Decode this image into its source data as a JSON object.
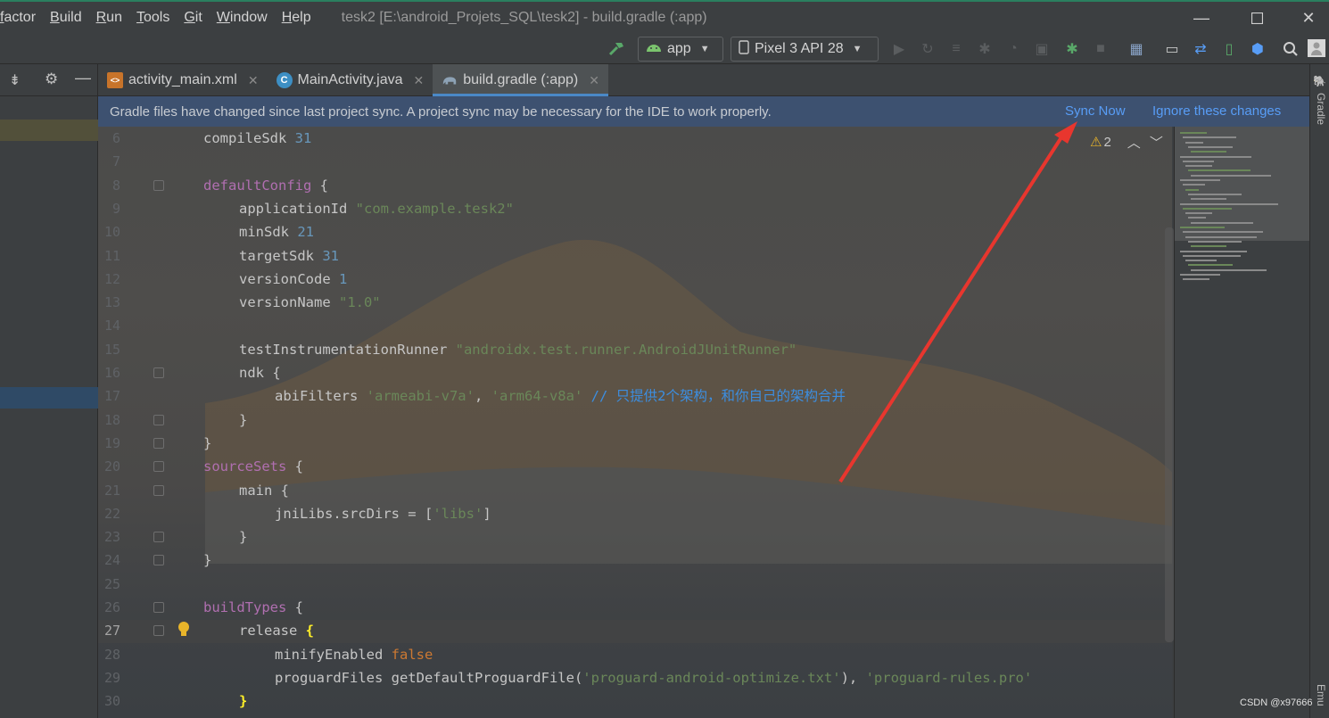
{
  "menu": [
    "factor",
    "Build",
    "Run",
    "Tools",
    "Git",
    "Window",
    "Help"
  ],
  "window_title": "tesk2 [E:\\android_Projets_SQL\\tesk2] - build.gradle (:app)",
  "toolbar": {
    "config": "app",
    "device": "Pixel 3 API 28"
  },
  "tabs": [
    {
      "label": "activity_main.xml",
      "icon": "xml-file-icon"
    },
    {
      "label": "MainActivity.java",
      "icon": "java-class-icon",
      "glyph": "C"
    },
    {
      "label": "build.gradle (:app)",
      "icon": "gradle-elephant-icon"
    }
  ],
  "banner": {
    "message": "Gradle files have changed since last project sync. A project sync may be necessary for the IDE to work properly.",
    "sync_now": "Sync Now",
    "ignore": "Ignore these changes"
  },
  "inspections": {
    "warnings": "2"
  },
  "current_line": 27,
  "code_lines": [
    {
      "n": "6",
      "text": "compileSdk 31"
    },
    {
      "n": "7",
      "text": ""
    },
    {
      "n": "8",
      "text": "defaultConfig {"
    },
    {
      "n": "9",
      "text": "applicationId \"com.example.tesk2\""
    },
    {
      "n": "10",
      "text": "minSdk 21"
    },
    {
      "n": "11",
      "text": "targetSdk 31"
    },
    {
      "n": "12",
      "text": "versionCode 1"
    },
    {
      "n": "13",
      "text": "versionName \"1.0\""
    },
    {
      "n": "14",
      "text": ""
    },
    {
      "n": "15",
      "text": "testInstrumentationRunner \"androidx.test.runner.AndroidJUnitRunner\""
    },
    {
      "n": "16",
      "text": "ndk {"
    },
    {
      "n": "17",
      "text": "abiFilters 'armeabi-v7a', 'arm64-v8a' // 只提供2个架构，和你自己的架构合并"
    },
    {
      "n": "18",
      "text": "}"
    },
    {
      "n": "19",
      "text": "}"
    },
    {
      "n": "20",
      "text": "sourceSets {"
    },
    {
      "n": "21",
      "text": "main {"
    },
    {
      "n": "22",
      "text": "jniLibs.srcDirs = ['libs']"
    },
    {
      "n": "23",
      "text": "}"
    },
    {
      "n": "24",
      "text": "}"
    },
    {
      "n": "25",
      "text": ""
    },
    {
      "n": "26",
      "text": "buildTypes {"
    },
    {
      "n": "27",
      "text": "release {"
    },
    {
      "n": "28",
      "text": "minifyEnabled false"
    },
    {
      "n": "29",
      "text": "proguardFiles getDefaultProguardFile('proguard-android-optimize.txt'), 'proguard-rules.pro'"
    },
    {
      "n": "30",
      "text": "}"
    }
  ],
  "right_tools": [
    "Gradle",
    "Emu"
  ],
  "watermark": "CSDN @x97666",
  "colors": {
    "keyword": "#b06fb0",
    "number": "#6897bb",
    "string": "#6a8759",
    "boolean": "#cc7832",
    "comment": "#3c8ee0",
    "link": "#589df6",
    "banner": "#3d5170",
    "arrow": "#e8362e"
  }
}
